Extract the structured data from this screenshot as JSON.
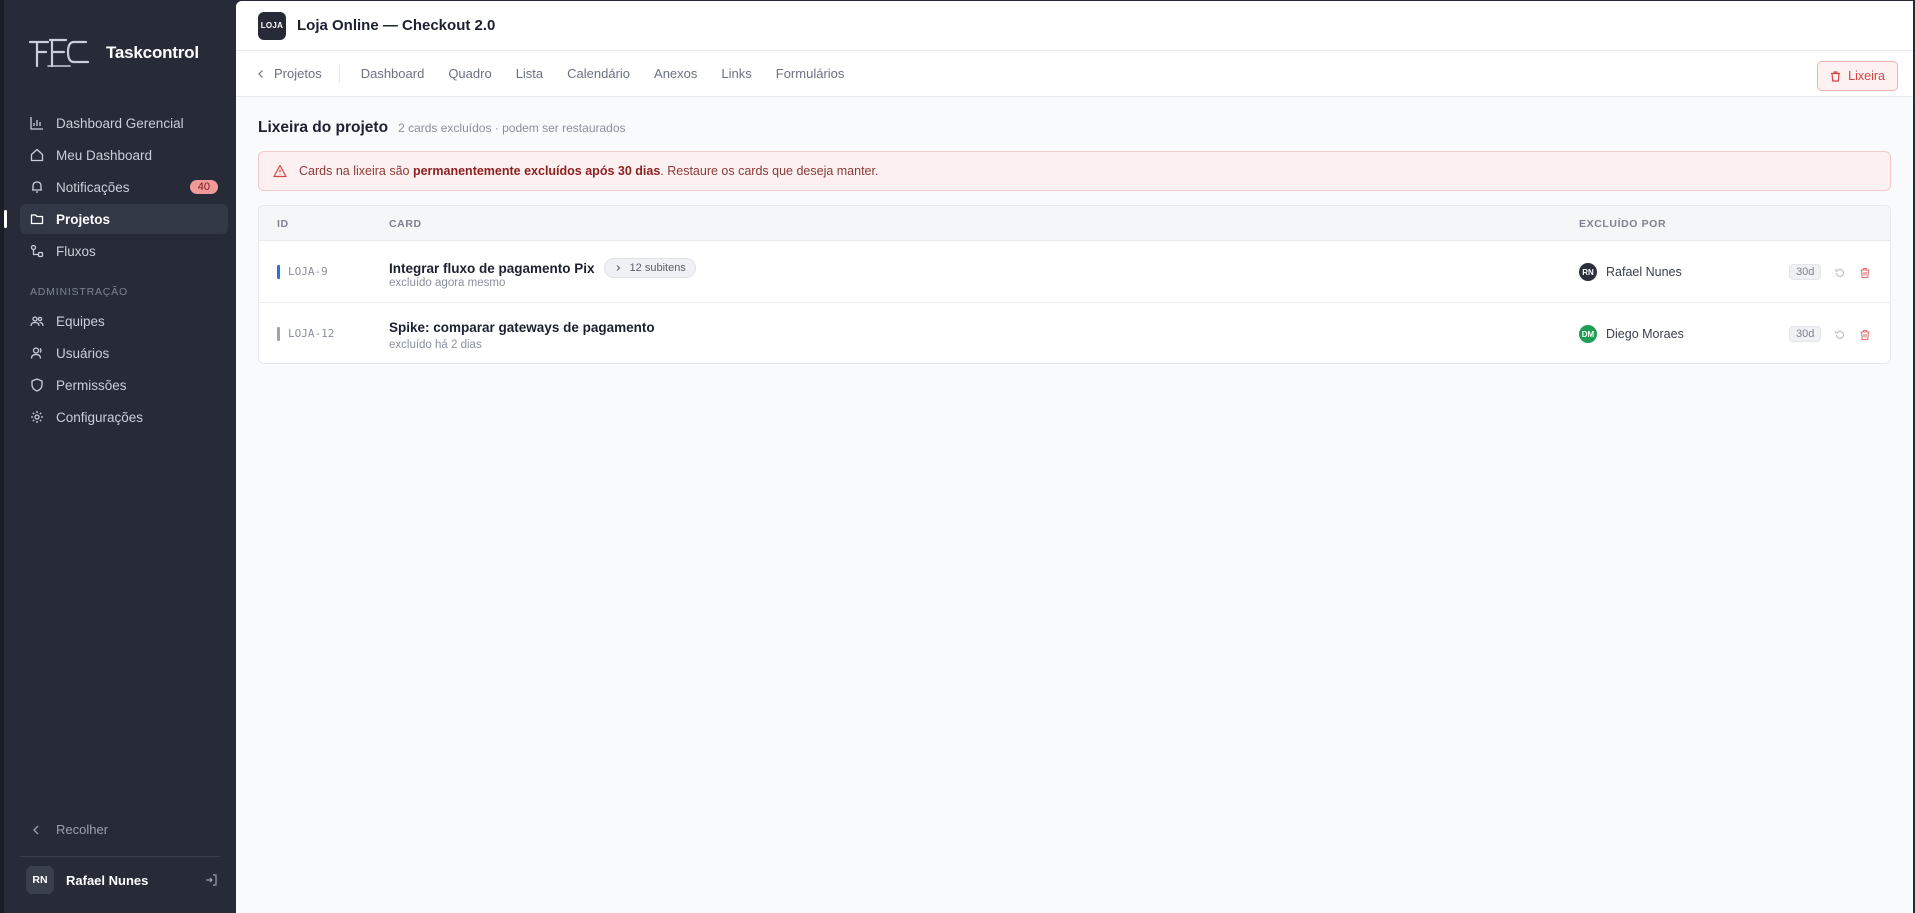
{
  "app": {
    "name": "Taskcontrol"
  },
  "sidebar": {
    "items": [
      {
        "label": "Dashboard Gerencial",
        "icon": "bar-chart-icon"
      },
      {
        "label": "Meu Dashboard",
        "icon": "home-icon"
      },
      {
        "label": "Notificações",
        "icon": "bell-icon",
        "badge": "40"
      },
      {
        "label": "Projetos",
        "icon": "folder-icon",
        "active": true
      },
      {
        "label": "Fluxos",
        "icon": "workflow-icon"
      }
    ],
    "section_admin": "ADMINISTRAÇÃO",
    "admin_items": [
      {
        "label": "Equipes",
        "icon": "team-icon"
      },
      {
        "label": "Usuários",
        "icon": "user-icon"
      },
      {
        "label": "Permissões",
        "icon": "shield-icon"
      },
      {
        "label": "Configurações",
        "icon": "gear-icon"
      }
    ],
    "collapse_label": "Recolher",
    "user": {
      "initials": "RN",
      "name": "Rafael Nunes"
    }
  },
  "project": {
    "logo_text": "LOJA",
    "title": "Loja Online — Checkout 2.0"
  },
  "tabs": {
    "back_label": "Projetos",
    "items": [
      "Dashboard",
      "Quadro",
      "Lista",
      "Calendário",
      "Anexos",
      "Links",
      "Formulários"
    ],
    "trash_label": "Lixeira"
  },
  "page": {
    "title": "Lixeira do projeto",
    "subtitle": "2 cards excluídos · podem ser restaurados"
  },
  "alert": {
    "prefix": "Cards na lixeira são ",
    "bold": "permanentemente excluídos após 30 dias",
    "suffix": ". Restaure os cards que deseja manter."
  },
  "table": {
    "headers": {
      "id": "ID",
      "card": "CARD",
      "deleted_by": "EXCLUÍDO POR"
    },
    "rows": [
      {
        "id": "LOJA-9",
        "title": "Integrar fluxo de pagamento Pix",
        "subitems": "12 subitens",
        "when": "excluído agora mesmo",
        "user_initials": "RN",
        "user_name": "Rafael Nunes",
        "days": "30d",
        "mark_color": "#2f6fd6",
        "avatar_color": "#2b303c"
      },
      {
        "id": "LOJA-12",
        "title": "Spike: comparar gateways de pagamento",
        "when": "excluído há 2 dias",
        "user_initials": "DM",
        "user_name": "Diego Moraes",
        "days": "30d",
        "mark_color": "#a0a4ae",
        "avatar_color": "#1f9d55"
      }
    ]
  },
  "colors": {
    "sidebar_bg": "#262b37",
    "danger": "#d64545",
    "alert_bg": "#fdf0f0"
  }
}
